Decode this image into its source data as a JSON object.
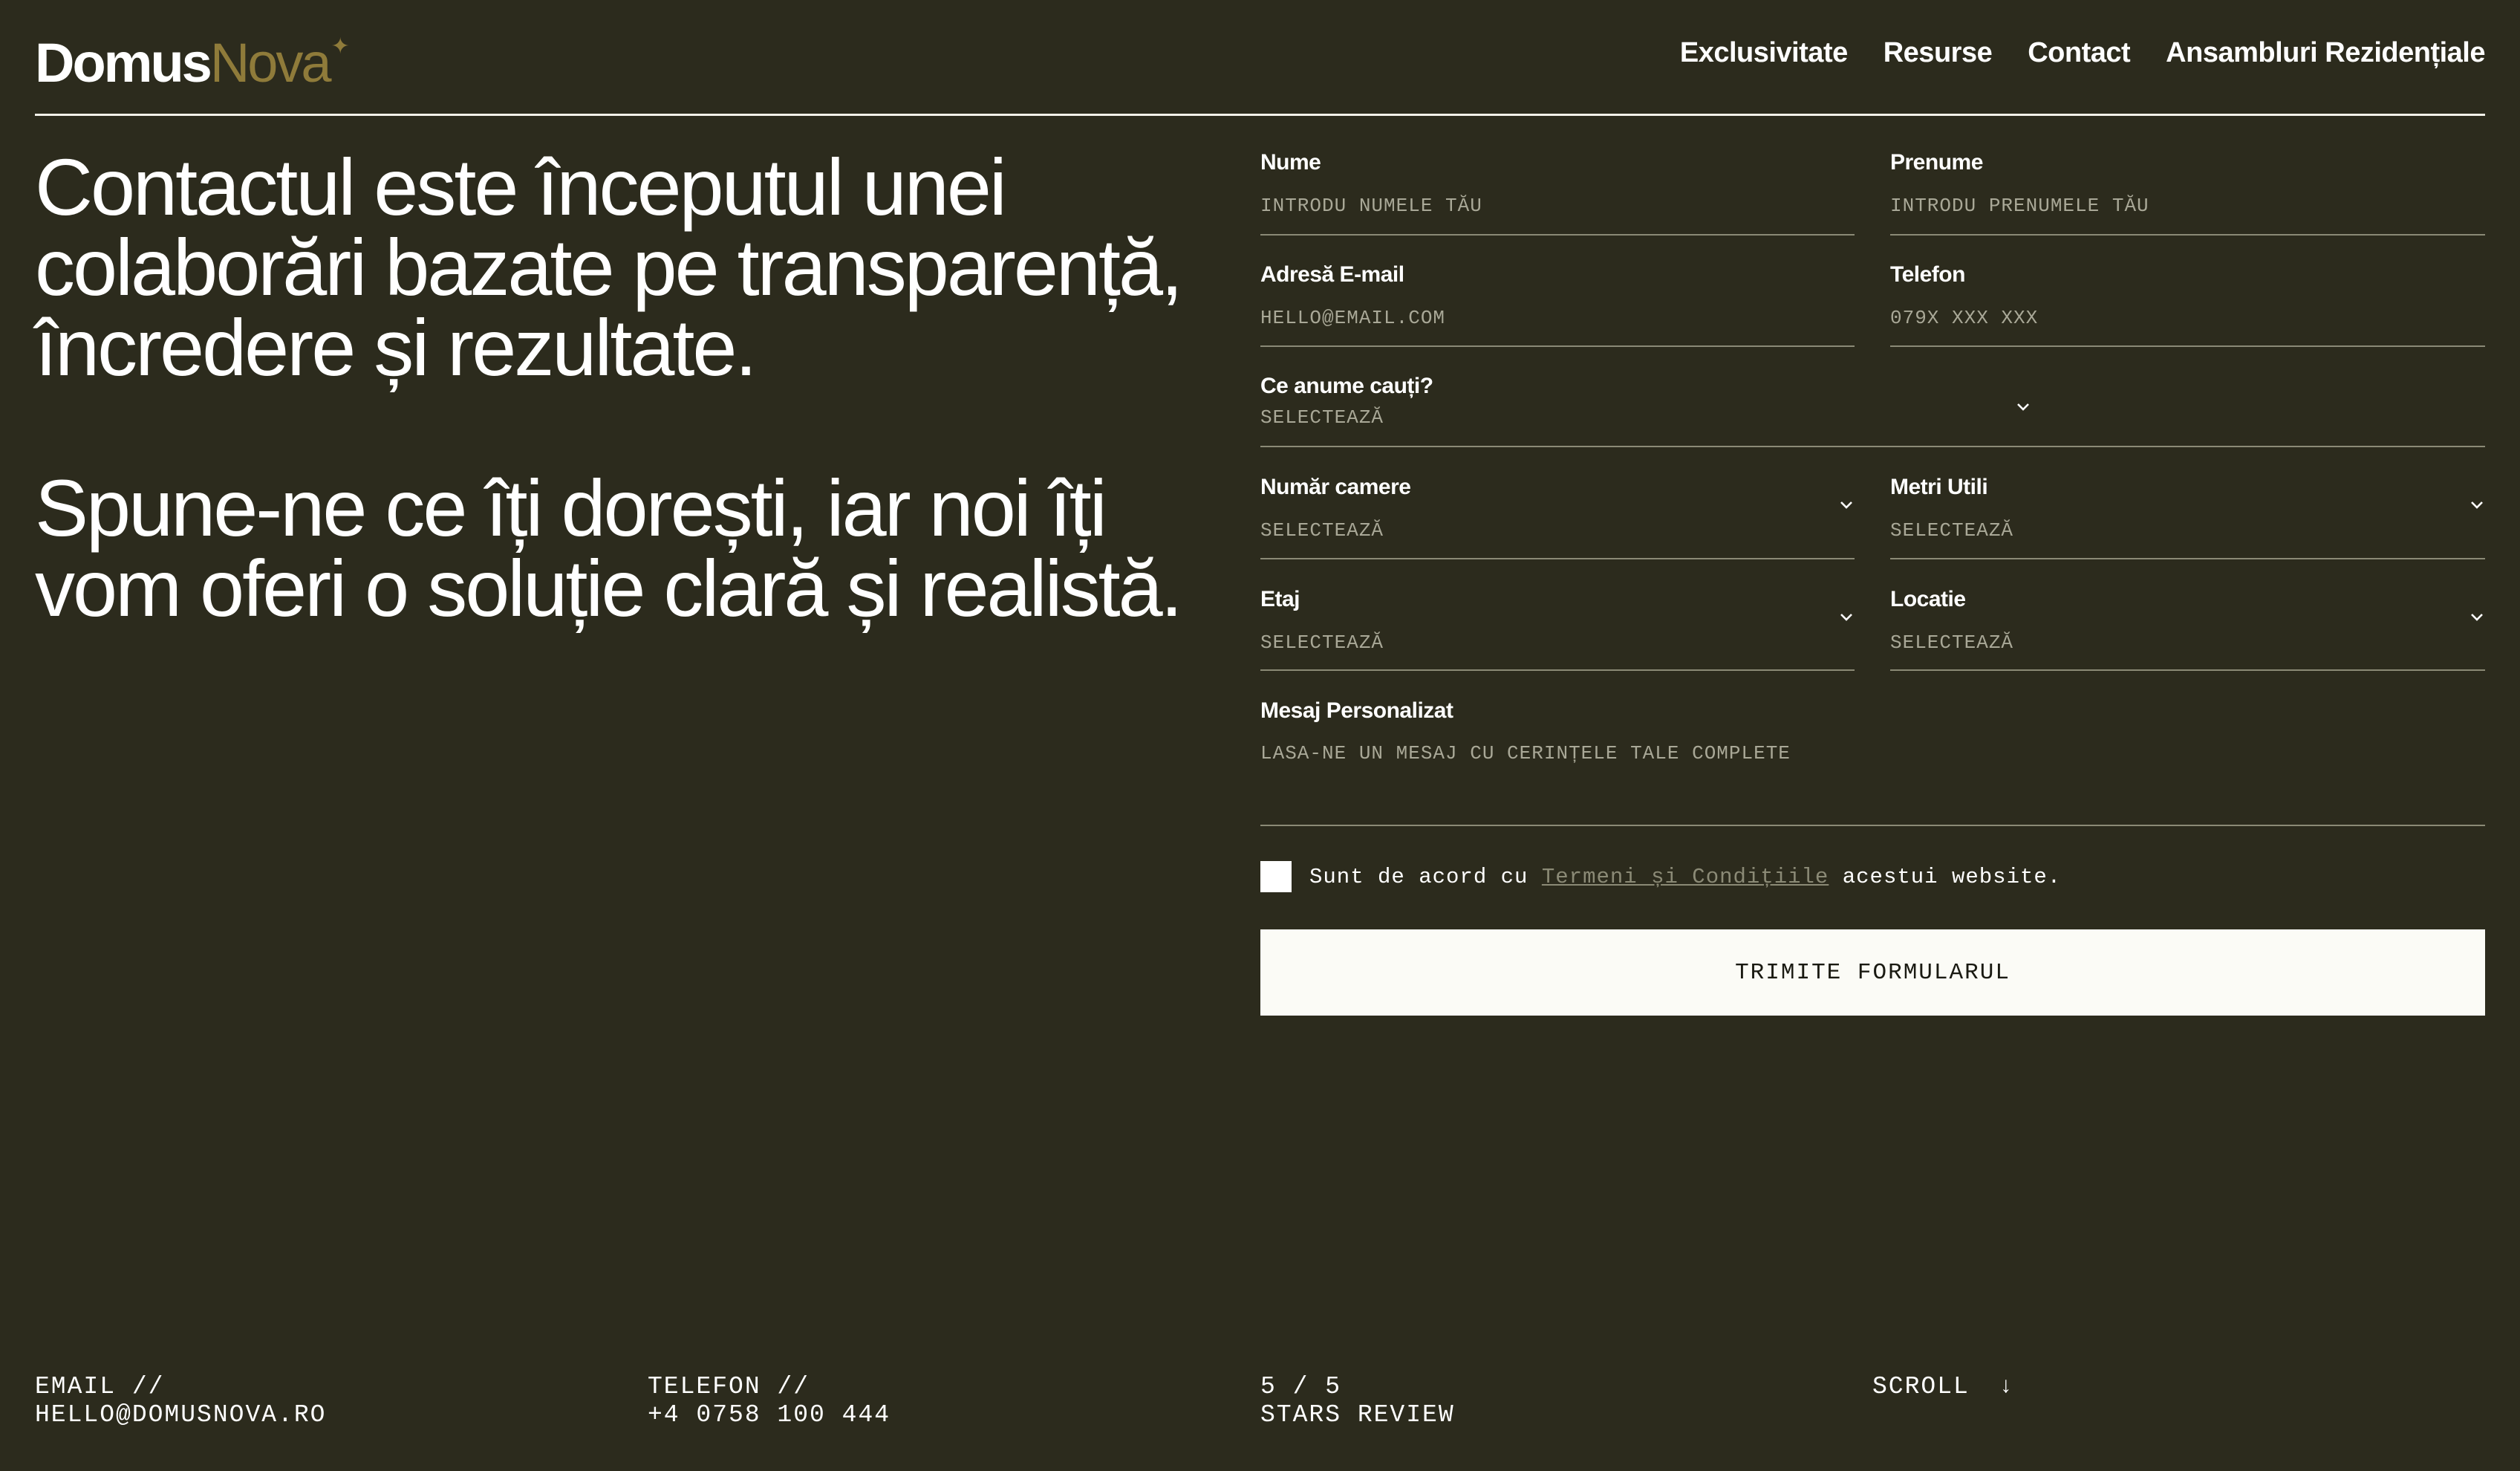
{
  "logo": {
    "part1": "Domus",
    "part2": "Nova",
    "star": "✦"
  },
  "nav": [
    {
      "label": "Exclusivitate"
    },
    {
      "label": "Resurse"
    },
    {
      "label": "Contact"
    },
    {
      "label": "Ansambluri Rezidențiale"
    }
  ],
  "hero": {
    "paragraph1": "Contactul este începutul unei colaborări bazate pe transparență, încredere și rezultate.",
    "paragraph2": "Spune-ne ce îți dorești, iar noi îți vom oferi o soluție clară și realistă."
  },
  "form": {
    "nume": {
      "label": "Nume",
      "placeholder": "INTRODU NUMELE TĂU"
    },
    "prenume": {
      "label": "Prenume",
      "placeholder": "INTRODU PRENUMELE TĂU"
    },
    "email": {
      "label": "Adresă E-mail",
      "placeholder": "HELLO@EMAIL.COM"
    },
    "telefon": {
      "label": "Telefon",
      "placeholder": "079X XXX XXX"
    },
    "cauti": {
      "label": "Ce anume cauți?",
      "value": "SELECTEAZĂ"
    },
    "camere": {
      "label": "Număr camere",
      "value": "SELECTEAZĂ"
    },
    "metri": {
      "label": "Metri Utili",
      "value": "SELECTEAZĂ"
    },
    "etaj": {
      "label": "Etaj",
      "value": "SELECTEAZĂ"
    },
    "locatie": {
      "label": "Locatie",
      "value": "SELECTEAZĂ"
    },
    "mesaj": {
      "label": "Mesaj Personalizat",
      "placeholder": "LASA-NE UN MESAJ CU CERINȚELE TALE COMPLETE"
    },
    "consent": {
      "before": "Sunt de acord cu ",
      "link": "Termeni și Condițiile",
      "after": " acestui website."
    },
    "submit": "TRIMITE FORMULARUL"
  },
  "footer": {
    "email_label": "EMAIL //",
    "email_value": "HELLO@DOMUSNOVA.RO",
    "phone_label": "TELEFON //",
    "phone_value": "+4 0758 100 444",
    "rating_value": "5 / 5",
    "rating_label": "STARS REVIEW",
    "scroll": "SCROLL",
    "scroll_arrow": "↓"
  },
  "colors": {
    "background": "#2c2b1d",
    "accent_gold": "#8f7b3a",
    "divider": "#8b8a76",
    "button_bg": "#fbfbf6"
  },
  "icons": {
    "chevron": "chevron-down-icon",
    "arrow": "arrow-down-icon",
    "star": "sparkle-icon"
  }
}
